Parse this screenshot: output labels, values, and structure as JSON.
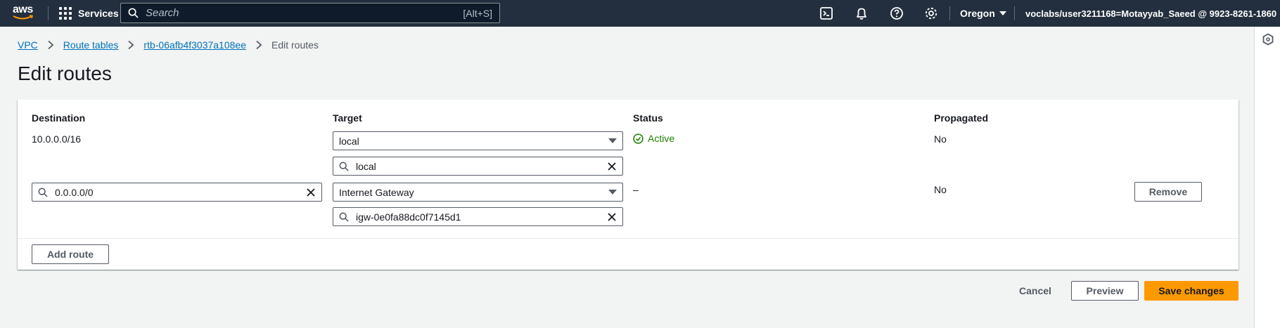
{
  "nav": {
    "logo": "aws",
    "services": "Services",
    "search_placeholder": "Search",
    "search_shortcut": "[Alt+S]",
    "region": "Oregon",
    "account": "voclabs/user3211168=Motayyab_Saeed @ 9923-8261-1860",
    "icons": [
      "cloudshell-icon",
      "bell-icon",
      "help-icon",
      "settings-icon"
    ]
  },
  "breadcrumb": {
    "items": [
      "VPC",
      "Route tables",
      "rtb-06afb4f3037a108ee"
    ],
    "current": "Edit routes"
  },
  "page_title": "Edit routes",
  "table": {
    "headers": {
      "destination": "Destination",
      "target": "Target",
      "status": "Status",
      "propagated": "Propagated"
    },
    "rows": [
      {
        "destination": "10.0.0.0/16",
        "target_type": "local",
        "target_value": "local",
        "status": "Active",
        "propagated": "No"
      },
      {
        "destination": "0.0.0.0/0",
        "target_type": "Internet Gateway",
        "target_value": "igw-0e0fa88dc0f7145d1",
        "status": "–",
        "propagated": "No",
        "remove_label": "Remove"
      }
    ]
  },
  "add_route_label": "Add route",
  "footer": {
    "cancel": "Cancel",
    "preview": "Preview",
    "save": "Save changes"
  },
  "colors": {
    "nav_bg": "#232f3e",
    "link": "#0073bb",
    "primary": "#ff9900",
    "success": "#1d8102"
  }
}
